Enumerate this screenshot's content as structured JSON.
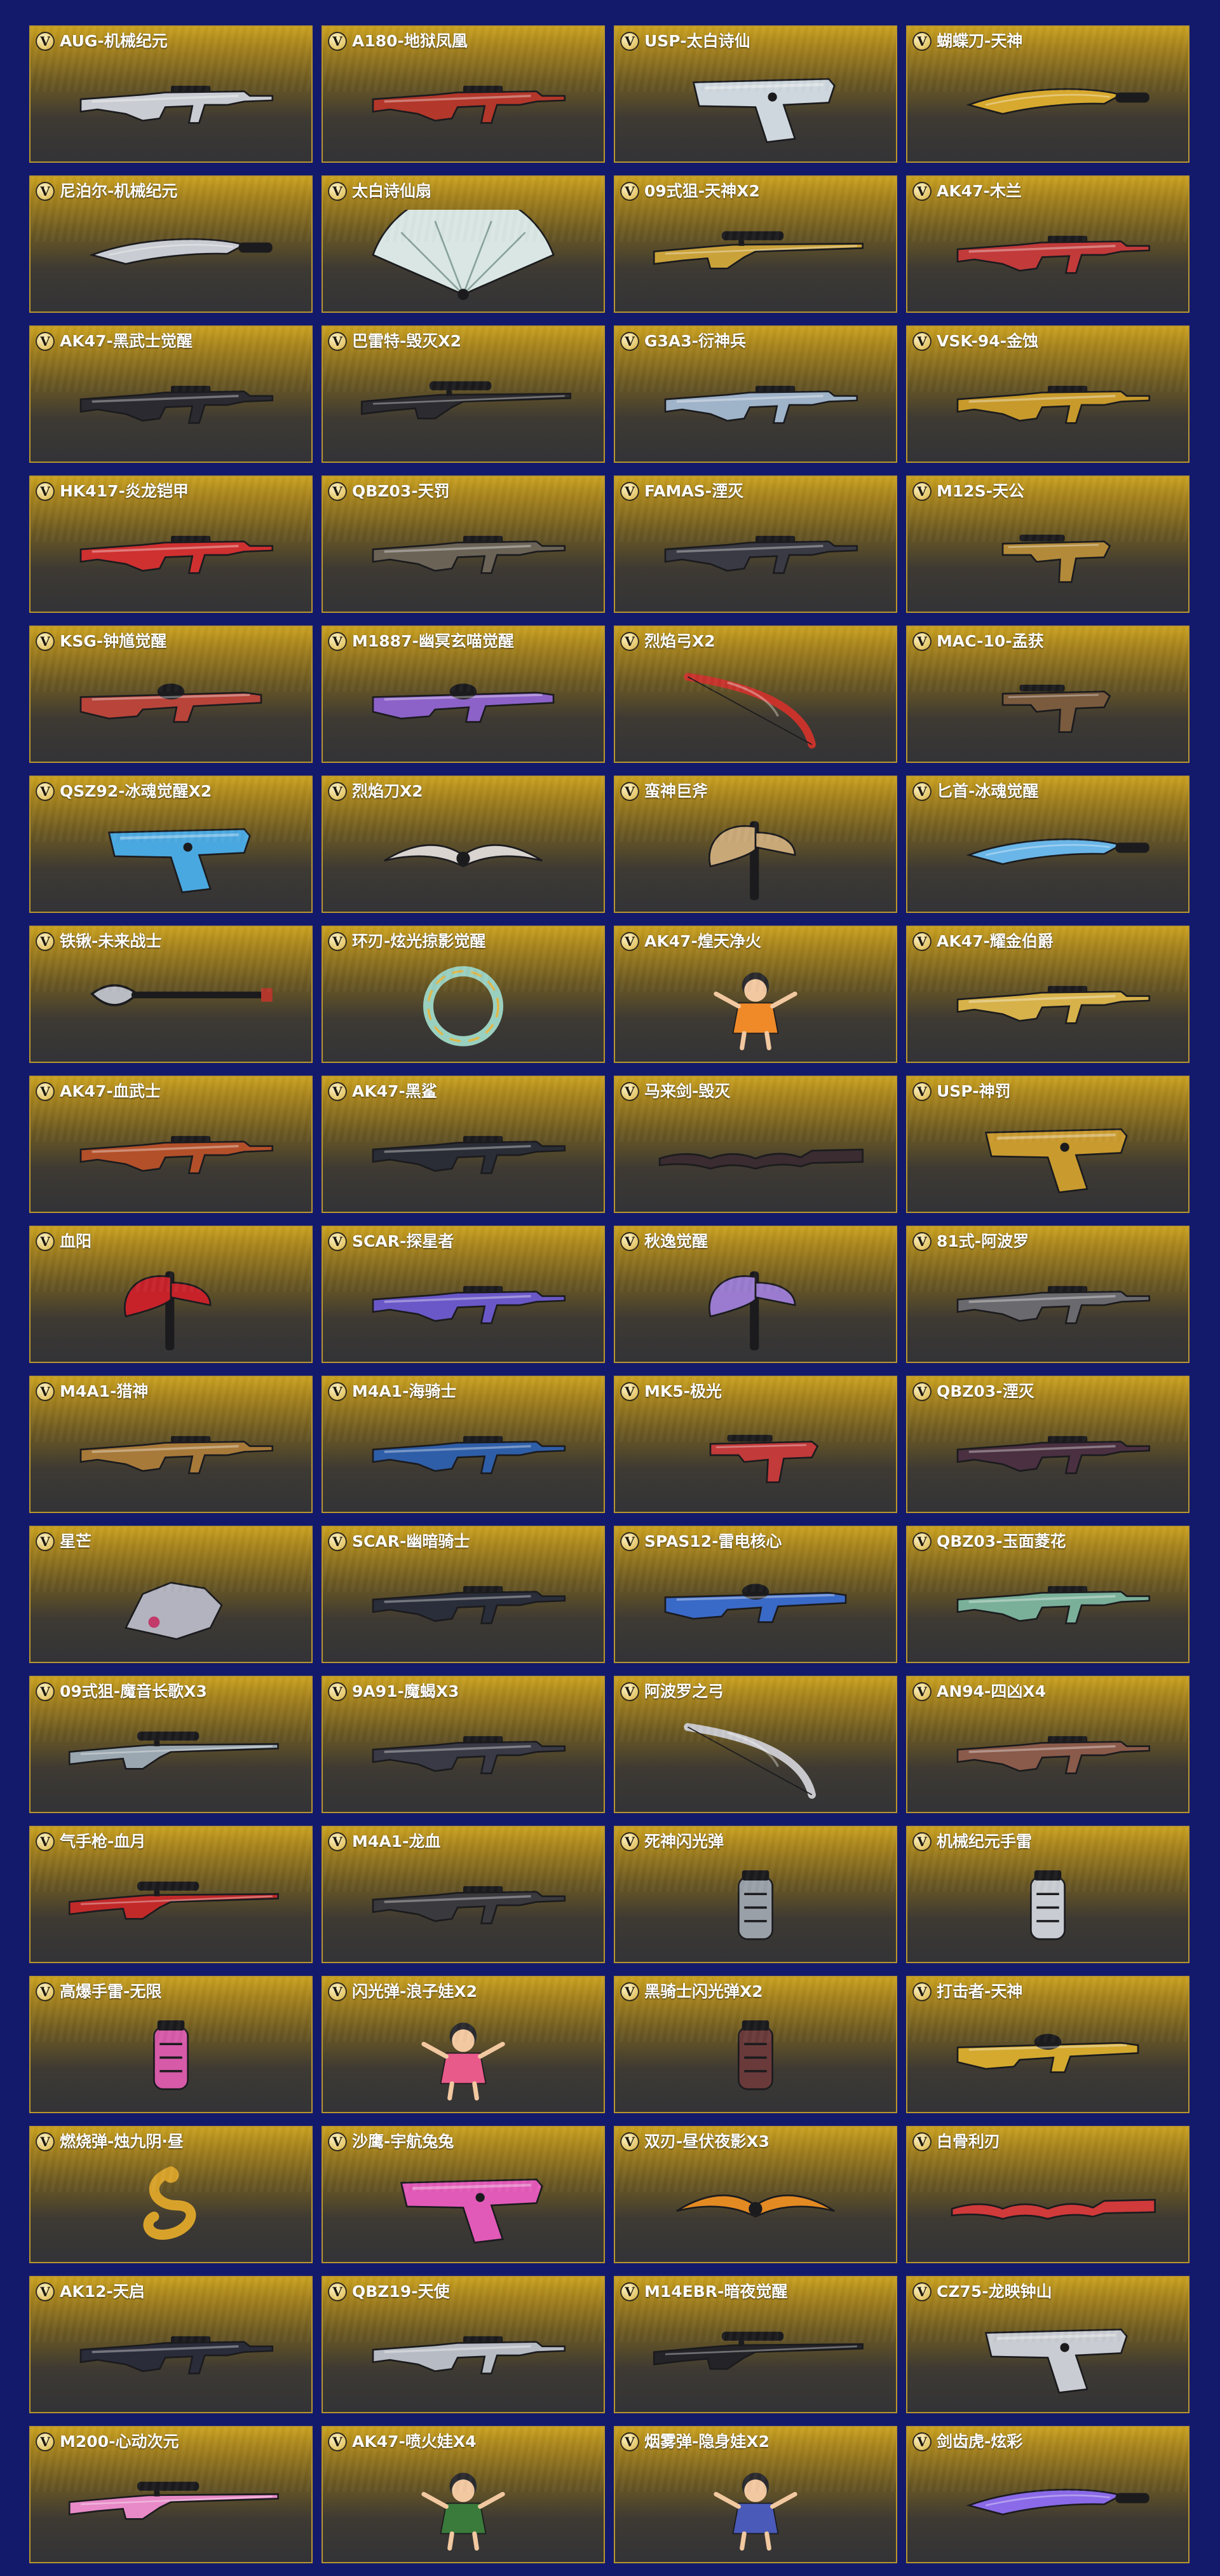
{
  "badge_letter": "V",
  "colors": {
    "background": "#141a6b",
    "card_gold": "#c9a11f",
    "card_dark": "#333336",
    "card_border": "#b8962f"
  },
  "items": [
    {
      "name": "AUG-机械纪元",
      "kind": "rifle",
      "color": "#c9ccd2"
    },
    {
      "name": "A180-地狱凤凰",
      "kind": "rifle",
      "color": "#b3372a"
    },
    {
      "name": "USP-太白诗仙",
      "kind": "pistol",
      "color": "#cfd7de"
    },
    {
      "name": "蝴蝶刀-天神",
      "kind": "knife",
      "color": "#d7a92e"
    },
    {
      "name": "尼泊尔-机械纪元",
      "kind": "knife",
      "color": "#c9ccd2"
    },
    {
      "name": "太白诗仙扇",
      "kind": "fan",
      "color": "#d9e6e3"
    },
    {
      "name": "09式狙-天神X2",
      "kind": "sniper",
      "color": "#caa23a"
    },
    {
      "name": "AK47-木兰",
      "kind": "rifle",
      "color": "#c23a3a"
    },
    {
      "name": "AK47-黑武士觉醒",
      "kind": "rifle",
      "color": "#2a2a30"
    },
    {
      "name": "巴雷特-毁灭X2",
      "kind": "sniper",
      "color": "#2c2c30"
    },
    {
      "name": "G3A3-衍神兵",
      "kind": "rifle",
      "color": "#9fb3c9"
    },
    {
      "name": "VSK-94-金蚀",
      "kind": "rifle",
      "color": "#c79a2b"
    },
    {
      "name": "HK417-炎龙铠甲",
      "kind": "rifle",
      "color": "#cf3030"
    },
    {
      "name": "QBZ03-天罚",
      "kind": "rifle",
      "color": "#6b6356"
    },
    {
      "name": "FAMAS-湮灭",
      "kind": "rifle",
      "color": "#3a3a44"
    },
    {
      "name": "M12S-天公",
      "kind": "smg",
      "color": "#b38a3a"
    },
    {
      "name": "KSG-钟馗觉醒",
      "kind": "shotgun",
      "color": "#b8443a"
    },
    {
      "name": "M1887-幽冥玄喵觉醒",
      "kind": "shotgun",
      "color": "#8c62c8"
    },
    {
      "name": "烈焰弓X2",
      "kind": "bow",
      "color": "#c7332b"
    },
    {
      "name": "MAC-10-孟获",
      "kind": "smg",
      "color": "#7a5b3e"
    },
    {
      "name": "QSZ92-冰魂觉醒X2",
      "kind": "pistol",
      "color": "#4aa8e0"
    },
    {
      "name": "烈焰刀X2",
      "kind": "blades",
      "color": "#d9d4d0"
    },
    {
      "name": "蛮神巨斧",
      "kind": "axe",
      "color": "#c9a878"
    },
    {
      "name": "匕首-冰魂觉醒",
      "kind": "dagger",
      "color": "#6ab6e8"
    },
    {
      "name": "铁锹-未来战士",
      "kind": "shovel",
      "color": "#b9bcc2"
    },
    {
      "name": "环刃-炫光掠影觉醒",
      "kind": "ring",
      "color": "#9ad0c0"
    },
    {
      "name": "AK47-煌天净火",
      "kind": "character",
      "color": "#f08a28"
    },
    {
      "name": "AK47-耀金伯爵",
      "kind": "rifle",
      "color": "#d7b24a"
    },
    {
      "name": "AK47-血武士",
      "kind": "rifle",
      "color": "#b3502a"
    },
    {
      "name": "AK47-黑鲨",
      "kind": "rifle",
      "color": "#2a2d36"
    },
    {
      "name": "马来剑-毁灭",
      "kind": "sword",
      "color": "#3a2c30"
    },
    {
      "name": "USP-神罚",
      "kind": "pistol",
      "color": "#c99a2e"
    },
    {
      "name": "血阳",
      "kind": "axe",
      "color": "#c7222a"
    },
    {
      "name": "SCAR-探星者",
      "kind": "rifle",
      "color": "#6a58c8"
    },
    {
      "name": "秋逸觉醒",
      "kind": "axe",
      "color": "#9a7bcf"
    },
    {
      "name": "81式-阿波罗",
      "kind": "rifle",
      "color": "#6a6a6e"
    },
    {
      "name": "M4A1-猎神",
      "kind": "rifle",
      "color": "#a87a3a"
    },
    {
      "name": "M4A1-海骑士",
      "kind": "rifle",
      "color": "#2f5ea8"
    },
    {
      "name": "MK5-极光",
      "kind": "smg",
      "color": "#c23a3a"
    },
    {
      "name": "QBZ03-湮灭",
      "kind": "rifle",
      "color": "#4a3040"
    },
    {
      "name": "星芒",
      "kind": "gauntlet",
      "color": "#b3b3bf"
    },
    {
      "name": "SCAR-幽暗骑士",
      "kind": "rifle",
      "color": "#2a2e3a"
    },
    {
      "name": "SPAS12-雷电核心",
      "kind": "shotgun",
      "color": "#3a6ac8"
    },
    {
      "name": "QBZ03-玉面菱花",
      "kind": "rifle",
      "color": "#7ab09a"
    },
    {
      "name": "09式狙-魔音长歌X3",
      "kind": "sniper",
      "color": "#9aa7b0"
    },
    {
      "name": "9A91-魔蝎X3",
      "kind": "rifle",
      "color": "#3a3a46"
    },
    {
      "name": "阿波罗之弓",
      "kind": "bow",
      "color": "#c8c8cc"
    },
    {
      "name": "AN94-四凶X4",
      "kind": "rifle",
      "color": "#8a5a4a"
    },
    {
      "name": "气手枪-血月",
      "kind": "sniper",
      "color": "#c22a2a"
    },
    {
      "name": "M4A1-龙血",
      "kind": "rifle",
      "color": "#3a3a3e"
    },
    {
      "name": "死神闪光弹",
      "kind": "grenade",
      "color": "#9aa0a8"
    },
    {
      "name": "机械纪元手雷",
      "kind": "grenade",
      "color": "#c9ccd2"
    },
    {
      "name": "高爆手雷-无限",
      "kind": "grenade",
      "color": "#d65aa8"
    },
    {
      "name": "闪光弹-浪子娃X2",
      "kind": "character",
      "color": "#e85a8a"
    },
    {
      "name": "黑骑士闪光弹X2",
      "kind": "grenade",
      "color": "#6a3a3a"
    },
    {
      "name": "打击者-天神",
      "kind": "shotgun",
      "color": "#d4a92e"
    },
    {
      "name": "燃烧弹-烛九阴·昼",
      "kind": "dragon",
      "color": "#d8a22a"
    },
    {
      "name": "沙鹰-宇航兔兔",
      "kind": "pistol",
      "color": "#e25ab8"
    },
    {
      "name": "双刃-昼伏夜影X3",
      "kind": "blades",
      "color": "#e38a22"
    },
    {
      "name": "白骨利刃",
      "kind": "sword",
      "color": "#d03a3a"
    },
    {
      "name": "AK12-天启",
      "kind": "rifle",
      "color": "#2a2c3a"
    },
    {
      "name": "QBZ19-天使",
      "kind": "rifle",
      "color": "#b7bcc4"
    },
    {
      "name": "M14EBR-暗夜觉醒",
      "kind": "sniper",
      "color": "#242428"
    },
    {
      "name": "CZ75-龙映钟山",
      "kind": "pistol",
      "color": "#c9ccd2"
    },
    {
      "name": "M200-心动次元",
      "kind": "sniper",
      "color": "#e88ac8"
    },
    {
      "name": "AK47-喷火娃X4",
      "kind": "character",
      "color": "#3a7a3a"
    },
    {
      "name": "烟雾弹-隐身娃X2",
      "kind": "character",
      "color": "#4a5ab8"
    },
    {
      "name": "剑齿虎-炫彩",
      "kind": "dagger",
      "color": "#8a6ae8"
    }
  ]
}
